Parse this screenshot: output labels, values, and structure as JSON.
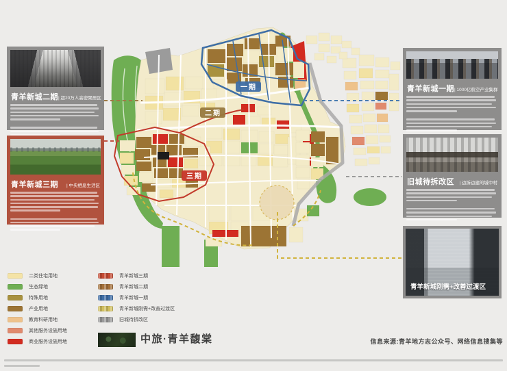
{
  "callouts": {
    "phase2": {
      "title": "青羊新城二期",
      "subtitle": "| 超20万人高密聚居区"
    },
    "phase3": {
      "title": "青羊新城三期",
      "subtitle": "| 中央栖息生活区"
    },
    "phase1": {
      "title": "青羊新城一期",
      "subtitle": "| 1000亿航空产业集群"
    },
    "oldtown": {
      "title": "旧城待拆改区",
      "subtitle": "| 边拆边建的城中村"
    },
    "transition": {
      "title": "青羊新城刚需+改善过渡区"
    }
  },
  "map": {
    "phase_labels": {
      "p1": "一期",
      "p2": "二期",
      "p3": "三期"
    }
  },
  "legend": {
    "left": [
      {
        "label": "二类住宅用地",
        "color": "#f4e3a6",
        "striped": false
      },
      {
        "label": "生态绿地",
        "color": "#6fae53",
        "striped": false
      },
      {
        "label": "特殊用地",
        "color": "#a8913f",
        "striped": false
      },
      {
        "label": "产业用地",
        "color": "#9c7434",
        "striped": false
      },
      {
        "label": "教育科研用地",
        "color": "#eec28c",
        "striped": false
      },
      {
        "label": "其他服务设施用地",
        "color": "#e08a6e",
        "striped": false
      },
      {
        "label": "商业服务设施用地",
        "color": "#d22b20",
        "striped": false
      }
    ],
    "right": [
      {
        "label": "青羊新城三期",
        "color": "#c64b33",
        "striped": true
      },
      {
        "label": "青羊新城二期",
        "color": "#a5713a",
        "striped": true
      },
      {
        "label": "青羊新城一期",
        "color": "#3e6ea6",
        "striped": true
      },
      {
        "label": "青羊新城刚需+改善过渡区",
        "color": "#d2c05e",
        "striped": true
      },
      {
        "label": "旧城待拆改区",
        "color": "#9b9b9b",
        "striped": true
      }
    ]
  },
  "brand": {
    "name": "中旅·青羊馥棠"
  },
  "footer": {
    "source": "信息来源:青羊地方志公众号、网络信息搜集等"
  },
  "palette": {
    "cream": "#f3ebc8",
    "residential": "#f2e2a2",
    "green": "#6fae53",
    "special": "#a8913f",
    "industry": "#9c7434",
    "education": "#eec28c",
    "services": "#e08a6e",
    "commercial": "#d22b20",
    "road_blue": "#3e6ea6",
    "outline_red": "#c23b2b",
    "road_gray": "#a9a9a9",
    "transition_yellow": "#d1b33c",
    "oldtown_gray": "#9b9b9b",
    "connector_brown": "#a07a45",
    "connector_red": "#c05040",
    "connector_blue": "#4a7cb0",
    "connector_gray": "#9a9a9a",
    "dark": "#1f1f1f"
  }
}
